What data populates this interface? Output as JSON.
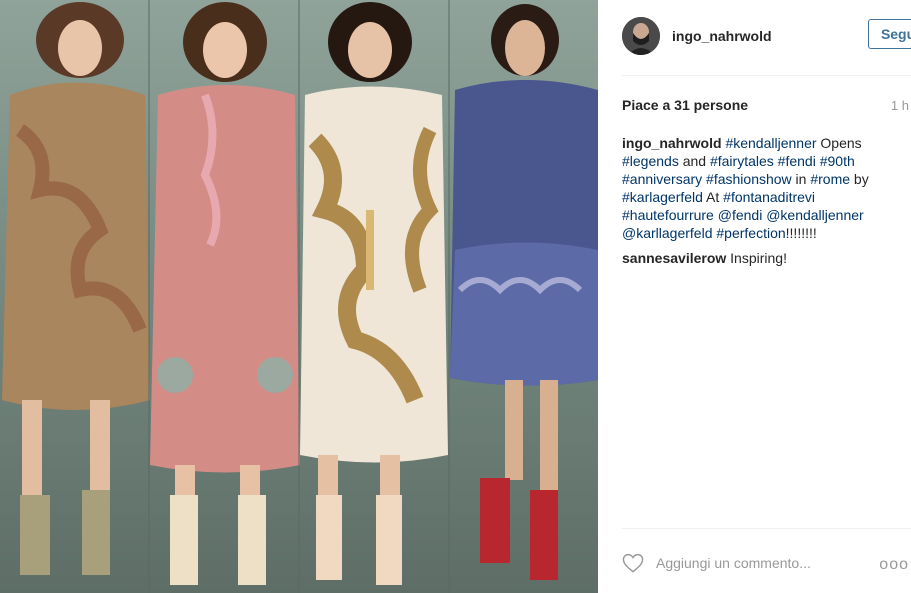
{
  "post": {
    "username": "ingo_nahrwold",
    "follow_label": "Segui",
    "likes_text": "Piace a 31 persone",
    "time_ago": "1 h",
    "caption": {
      "user": "ingo_nahrwold",
      "segments": [
        {
          "text": "#kendalljenner",
          "tag": true
        },
        {
          "text": " Opens ",
          "tag": false
        },
        {
          "text": "#legends",
          "tag": true
        },
        {
          "text": " and ",
          "tag": false
        },
        {
          "text": "#fairytales",
          "tag": true
        },
        {
          "text": " ",
          "tag": false
        },
        {
          "text": "#fendi",
          "tag": true
        },
        {
          "text": " ",
          "tag": false
        },
        {
          "text": "#90th",
          "tag": true
        },
        {
          "text": " ",
          "tag": false
        },
        {
          "text": "#anniversary",
          "tag": true
        },
        {
          "text": " ",
          "tag": false
        },
        {
          "text": "#fashionshow",
          "tag": true
        },
        {
          "text": " in ",
          "tag": false
        },
        {
          "text": "#rome",
          "tag": true
        },
        {
          "text": " by ",
          "tag": false
        },
        {
          "text": "#karlagerfeld",
          "tag": true
        },
        {
          "text": " At ",
          "tag": false
        },
        {
          "text": "#fontanaditrevi",
          "tag": true
        },
        {
          "text": " ",
          "tag": false
        },
        {
          "text": "#hautefourrure",
          "tag": true
        },
        {
          "text": " ",
          "tag": false
        },
        {
          "text": "@fendi",
          "tag": true
        },
        {
          "text": " ",
          "tag": false
        },
        {
          "text": "@kendalljenner",
          "tag": true
        },
        {
          "text": " ",
          "tag": false
        },
        {
          "text": "@karllagerfeld",
          "tag": true
        },
        {
          "text": " ",
          "tag": false
        },
        {
          "text": "#perfection",
          "tag": true
        },
        {
          "text": "!!!!!!!!",
          "tag": false
        }
      ]
    },
    "comments": [
      {
        "user": "sannesavilerow",
        "text": "Inspiring!"
      }
    ],
    "comment_placeholder": "Aggiungi un commento...",
    "more_label": "ooo",
    "icons": {
      "like": "heart-icon",
      "more": "more-options-icon"
    },
    "colors": {
      "link": "#003569",
      "follow": "#3f729b",
      "muted": "#999999"
    }
  }
}
